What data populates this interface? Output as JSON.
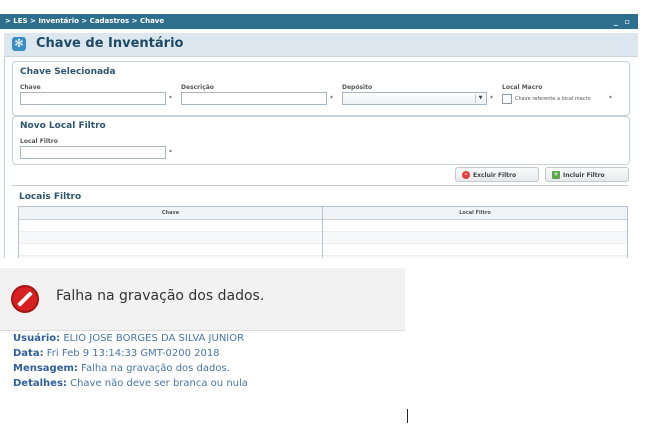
{
  "topbar": {
    "breadcrumb": "> LES > Inventário > Cadastros > Chave",
    "window_controls": "_ ▫"
  },
  "page_title": "Chave de Inventário",
  "chave_selecionada": {
    "title": "Chave Selecionada",
    "chave_label": "Chave",
    "chave_value": "",
    "descricao_label": "Descrição",
    "descricao_value": "",
    "deposito_label": "Depósito",
    "deposito_value": "",
    "local_macro_label": "Local Macro",
    "local_macro_checkbox_label": "Chave referente a local macro",
    "local_macro_checked": false,
    "required_mark": "*"
  },
  "novo_local": {
    "title": "Novo Local Filtro",
    "local_filtro_label": "Local Filtro",
    "local_filtro_value": "",
    "required_mark": "*"
  },
  "actions": {
    "excluir_label": "Excluir Filtro",
    "incluir_label": "Incluir Filtro"
  },
  "locais": {
    "title": "Locais Filtro",
    "columns": [
      "Chave",
      "Local Filtro"
    ],
    "rows": []
  },
  "error": {
    "title": "Falha na gravação dos dados.",
    "usuario_label": "Usuário:",
    "usuario_value": "ELIO JOSE BORGES DA SILVA JUNIOR",
    "data_label": "Data:",
    "data_value": "Fri Feb 9 13:14:33 GMT-0200 2018",
    "mensagem_label": "Mensagem:",
    "mensagem_value": "Falha na gravação dos dados.",
    "detalhes_label": "Detalhes:",
    "detalhes_value": "Chave não deve ser branca ou nula"
  },
  "colors": {
    "topbar": "#2f6f8e",
    "title_text": "#1f4a63",
    "error_red": "#d72020",
    "error_text": "#4a74a8"
  }
}
